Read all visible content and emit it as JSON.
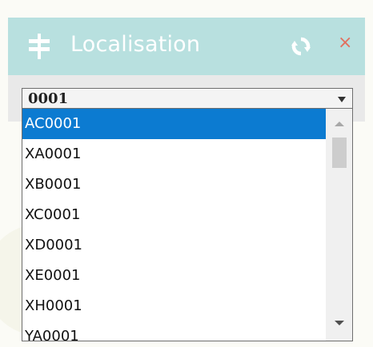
{
  "panel": {
    "title": "Localisation",
    "header_color": "#b8e0df",
    "icons": {
      "title_icon": "signpost-icon",
      "refresh_icon": "refresh-icon",
      "close_icon": "close-icon"
    },
    "close_glyph": "×"
  },
  "select": {
    "value": "0001"
  },
  "dropdown": {
    "selected_index": 0,
    "selected_color": "#0c7bd1",
    "options": [
      "AC0001",
      "XA0001",
      "XB0001",
      "XC0001",
      "XD0001",
      "XE0001",
      "XH0001",
      "YA0001"
    ]
  }
}
